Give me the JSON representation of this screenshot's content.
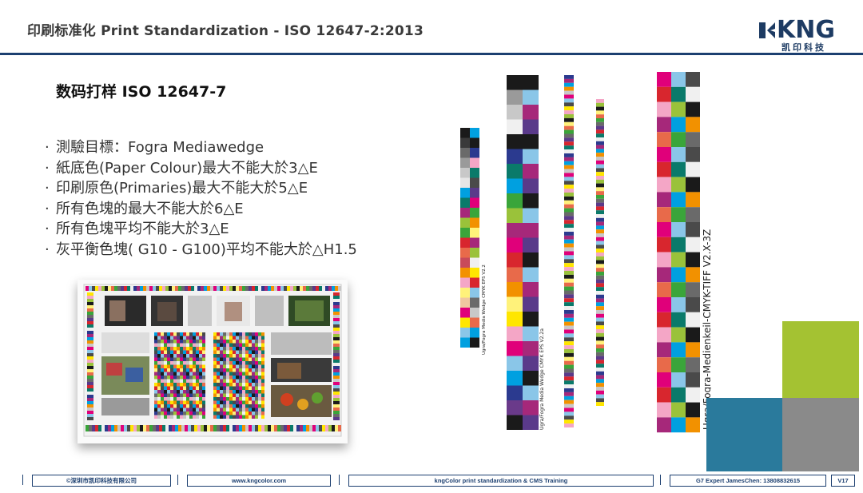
{
  "header": {
    "title": "印刷标准化 Print Standardization - ISO 12647-2:2013",
    "logo_text": "KNG",
    "logo_sub": "凯印科技"
  },
  "main": {
    "subtitle": "数码打样 ISO 12647-7",
    "bullets": [
      "測驗目標：Fogra Mediawedge",
      "紙底色(Paper Colour)最大不能大於3△E",
      "印刷原色(Primaries)最大不能大於5△E",
      "所有色塊的最大不能大於6△E",
      "所有色塊平均不能大於3△E",
      "灰平衡色塊( G10 - G100)平均不能大於△H1.5"
    ],
    "wedge_labels": [
      "Ugra/Fogra Media Wedge CMYK EPS V2.2",
      "Ugra/Fogra Media Wedge CMYK EPS V2.2a",
      "Ugra/Fogra-Medienkeil-CMYK-TIFF V2.X-3Z"
    ]
  },
  "footer": {
    "company": "©深圳市凯印科技有限公司",
    "website": "www.kngcolor.com",
    "training": "kngColor print standardization & CMS Training",
    "contact": "G7 Expert JamesChen: 13808832615",
    "version": "V17"
  },
  "colors": {
    "accent": "#1c3f70",
    "green": "#a4c232",
    "teal": "#2a7a9c",
    "gray": "#8a8a8a"
  }
}
